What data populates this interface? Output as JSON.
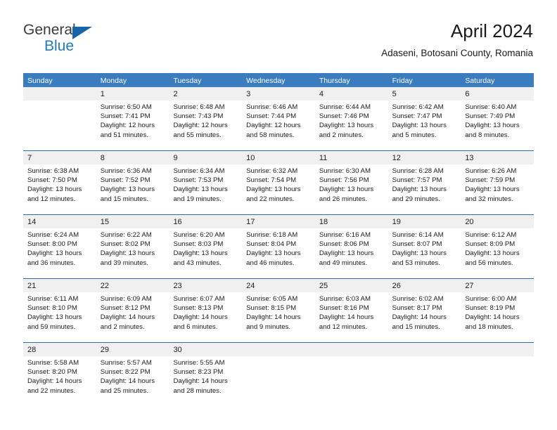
{
  "brand": {
    "name_primary": "General",
    "name_secondary": "Blue",
    "triangle_color": "#1565a8",
    "secondary_color": "#1f7ac0"
  },
  "header": {
    "title": "April 2024",
    "subtitle": "Adaseni, Botosani County, Romania"
  },
  "theme": {
    "header_bg": "#3a7cbe",
    "header_text": "#ffffff",
    "week_divider": "#2c6cad",
    "date_band_bg": "#f0f0f0",
    "cell_bg": "#ffffff",
    "text": "#1b1b1b"
  },
  "weekday_headers": [
    "Sunday",
    "Monday",
    "Tuesday",
    "Wednesday",
    "Thursday",
    "Friday",
    "Saturday"
  ],
  "weeks": [
    {
      "days": [
        {
          "date": "",
          "sunrise": "",
          "sunset": "",
          "daylight": "",
          "empty": true
        },
        {
          "date": "1",
          "sunrise": "Sunrise: 6:50 AM",
          "sunset": "Sunset: 7:41 PM",
          "daylight": "Daylight: 12 hours and 51 minutes.",
          "empty": false
        },
        {
          "date": "2",
          "sunrise": "Sunrise: 6:48 AM",
          "sunset": "Sunset: 7:43 PM",
          "daylight": "Daylight: 12 hours and 55 minutes.",
          "empty": false
        },
        {
          "date": "3",
          "sunrise": "Sunrise: 6:46 AM",
          "sunset": "Sunset: 7:44 PM",
          "daylight": "Daylight: 12 hours and 58 minutes.",
          "empty": false
        },
        {
          "date": "4",
          "sunrise": "Sunrise: 6:44 AM",
          "sunset": "Sunset: 7:46 PM",
          "daylight": "Daylight: 13 hours and 2 minutes.",
          "empty": false
        },
        {
          "date": "5",
          "sunrise": "Sunrise: 6:42 AM",
          "sunset": "Sunset: 7:47 PM",
          "daylight": "Daylight: 13 hours and 5 minutes.",
          "empty": false
        },
        {
          "date": "6",
          "sunrise": "Sunrise: 6:40 AM",
          "sunset": "Sunset: 7:49 PM",
          "daylight": "Daylight: 13 hours and 8 minutes.",
          "empty": false
        }
      ]
    },
    {
      "days": [
        {
          "date": "7",
          "sunrise": "Sunrise: 6:38 AM",
          "sunset": "Sunset: 7:50 PM",
          "daylight": "Daylight: 13 hours and 12 minutes.",
          "empty": false
        },
        {
          "date": "8",
          "sunrise": "Sunrise: 6:36 AM",
          "sunset": "Sunset: 7:52 PM",
          "daylight": "Daylight: 13 hours and 15 minutes.",
          "empty": false
        },
        {
          "date": "9",
          "sunrise": "Sunrise: 6:34 AM",
          "sunset": "Sunset: 7:53 PM",
          "daylight": "Daylight: 13 hours and 19 minutes.",
          "empty": false
        },
        {
          "date": "10",
          "sunrise": "Sunrise: 6:32 AM",
          "sunset": "Sunset: 7:54 PM",
          "daylight": "Daylight: 13 hours and 22 minutes.",
          "empty": false
        },
        {
          "date": "11",
          "sunrise": "Sunrise: 6:30 AM",
          "sunset": "Sunset: 7:56 PM",
          "daylight": "Daylight: 13 hours and 26 minutes.",
          "empty": false
        },
        {
          "date": "12",
          "sunrise": "Sunrise: 6:28 AM",
          "sunset": "Sunset: 7:57 PM",
          "daylight": "Daylight: 13 hours and 29 minutes.",
          "empty": false
        },
        {
          "date": "13",
          "sunrise": "Sunrise: 6:26 AM",
          "sunset": "Sunset: 7:59 PM",
          "daylight": "Daylight: 13 hours and 32 minutes.",
          "empty": false
        }
      ]
    },
    {
      "days": [
        {
          "date": "14",
          "sunrise": "Sunrise: 6:24 AM",
          "sunset": "Sunset: 8:00 PM",
          "daylight": "Daylight: 13 hours and 36 minutes.",
          "empty": false
        },
        {
          "date": "15",
          "sunrise": "Sunrise: 6:22 AM",
          "sunset": "Sunset: 8:02 PM",
          "daylight": "Daylight: 13 hours and 39 minutes.",
          "empty": false
        },
        {
          "date": "16",
          "sunrise": "Sunrise: 6:20 AM",
          "sunset": "Sunset: 8:03 PM",
          "daylight": "Daylight: 13 hours and 43 minutes.",
          "empty": false
        },
        {
          "date": "17",
          "sunrise": "Sunrise: 6:18 AM",
          "sunset": "Sunset: 8:04 PM",
          "daylight": "Daylight: 13 hours and 46 minutes.",
          "empty": false
        },
        {
          "date": "18",
          "sunrise": "Sunrise: 6:16 AM",
          "sunset": "Sunset: 8:06 PM",
          "daylight": "Daylight: 13 hours and 49 minutes.",
          "empty": false
        },
        {
          "date": "19",
          "sunrise": "Sunrise: 6:14 AM",
          "sunset": "Sunset: 8:07 PM",
          "daylight": "Daylight: 13 hours and 53 minutes.",
          "empty": false
        },
        {
          "date": "20",
          "sunrise": "Sunrise: 6:12 AM",
          "sunset": "Sunset: 8:09 PM",
          "daylight": "Daylight: 13 hours and 56 minutes.",
          "empty": false
        }
      ]
    },
    {
      "days": [
        {
          "date": "21",
          "sunrise": "Sunrise: 6:11 AM",
          "sunset": "Sunset: 8:10 PM",
          "daylight": "Daylight: 13 hours and 59 minutes.",
          "empty": false
        },
        {
          "date": "22",
          "sunrise": "Sunrise: 6:09 AM",
          "sunset": "Sunset: 8:12 PM",
          "daylight": "Daylight: 14 hours and 2 minutes.",
          "empty": false
        },
        {
          "date": "23",
          "sunrise": "Sunrise: 6:07 AM",
          "sunset": "Sunset: 8:13 PM",
          "daylight": "Daylight: 14 hours and 6 minutes.",
          "empty": false
        },
        {
          "date": "24",
          "sunrise": "Sunrise: 6:05 AM",
          "sunset": "Sunset: 8:15 PM",
          "daylight": "Daylight: 14 hours and 9 minutes.",
          "empty": false
        },
        {
          "date": "25",
          "sunrise": "Sunrise: 6:03 AM",
          "sunset": "Sunset: 8:16 PM",
          "daylight": "Daylight: 14 hours and 12 minutes.",
          "empty": false
        },
        {
          "date": "26",
          "sunrise": "Sunrise: 6:02 AM",
          "sunset": "Sunset: 8:17 PM",
          "daylight": "Daylight: 14 hours and 15 minutes.",
          "empty": false
        },
        {
          "date": "27",
          "sunrise": "Sunrise: 6:00 AM",
          "sunset": "Sunset: 8:19 PM",
          "daylight": "Daylight: 14 hours and 18 minutes.",
          "empty": false
        }
      ]
    },
    {
      "days": [
        {
          "date": "28",
          "sunrise": "Sunrise: 5:58 AM",
          "sunset": "Sunset: 8:20 PM",
          "daylight": "Daylight: 14 hours and 22 minutes.",
          "empty": false
        },
        {
          "date": "29",
          "sunrise": "Sunrise: 5:57 AM",
          "sunset": "Sunset: 8:22 PM",
          "daylight": "Daylight: 14 hours and 25 minutes.",
          "empty": false
        },
        {
          "date": "30",
          "sunrise": "Sunrise: 5:55 AM",
          "sunset": "Sunset: 8:23 PM",
          "daylight": "Daylight: 14 hours and 28 minutes.",
          "empty": false
        },
        {
          "date": "",
          "sunrise": "",
          "sunset": "",
          "daylight": "",
          "empty": true
        },
        {
          "date": "",
          "sunrise": "",
          "sunset": "",
          "daylight": "",
          "empty": true
        },
        {
          "date": "",
          "sunrise": "",
          "sunset": "",
          "daylight": "",
          "empty": true
        },
        {
          "date": "",
          "sunrise": "",
          "sunset": "",
          "daylight": "",
          "empty": true
        }
      ]
    }
  ]
}
